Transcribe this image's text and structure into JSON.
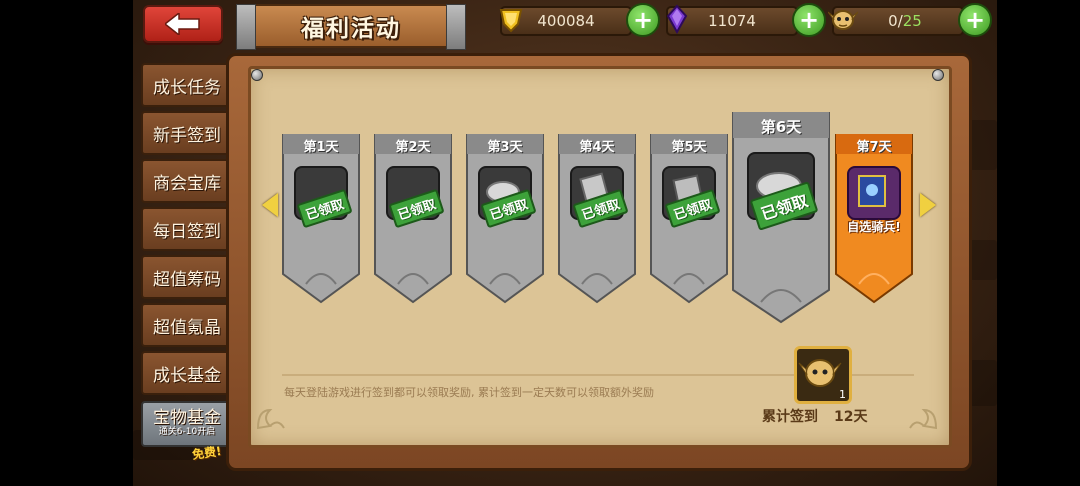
{
  "header": {
    "title": "福利活动",
    "currencies": [
      {
        "name": "gold",
        "value": "400084"
      },
      {
        "name": "crystal",
        "value": "11074"
      }
    ],
    "population": {
      "current": "0",
      "max": "25"
    }
  },
  "sidebar": {
    "items": [
      {
        "label": "成长任务"
      },
      {
        "label": "新手签到"
      },
      {
        "label": "商会宝库"
      },
      {
        "label": "每日签到"
      },
      {
        "label": "超值筹码"
      },
      {
        "label": "超值氪晶"
      },
      {
        "label": "成长基金"
      },
      {
        "label": "宝物基金",
        "sub": "通关6-10开启"
      }
    ],
    "free_tag": "免费!"
  },
  "checkin": {
    "days": [
      {
        "label": "第1天",
        "stamp": "已领取",
        "reward": "helmet-icon"
      },
      {
        "label": "第2天",
        "stamp": "已领取",
        "reward": "helmet-icon"
      },
      {
        "label": "第3天",
        "stamp": "已领取",
        "reward": "chip-icon"
      },
      {
        "label": "第4天",
        "stamp": "已领取",
        "reward": "scroll-icon"
      },
      {
        "label": "第5天",
        "stamp": "已领取",
        "reward": "mystery-card-icon"
      },
      {
        "label": "第6天",
        "stamp": "已领取",
        "reward": "chip-icon"
      },
      {
        "label": "第7天",
        "caption": "自选骑兵!",
        "reward": "knight-card-icon"
      }
    ],
    "hint": "每天登陆游戏进行签到都可以领取奖励, 累计签到一定天数可以领取额外奖励",
    "accumulate": {
      "label": "累计签到",
      "days": "12天",
      "reward_count": "1"
    }
  },
  "colors": {
    "claimed_stamp": "#3da23a",
    "active_banner": "#f08a20",
    "inactive_banner": "#9a9a9a",
    "plus_button": "#4caa2a"
  }
}
